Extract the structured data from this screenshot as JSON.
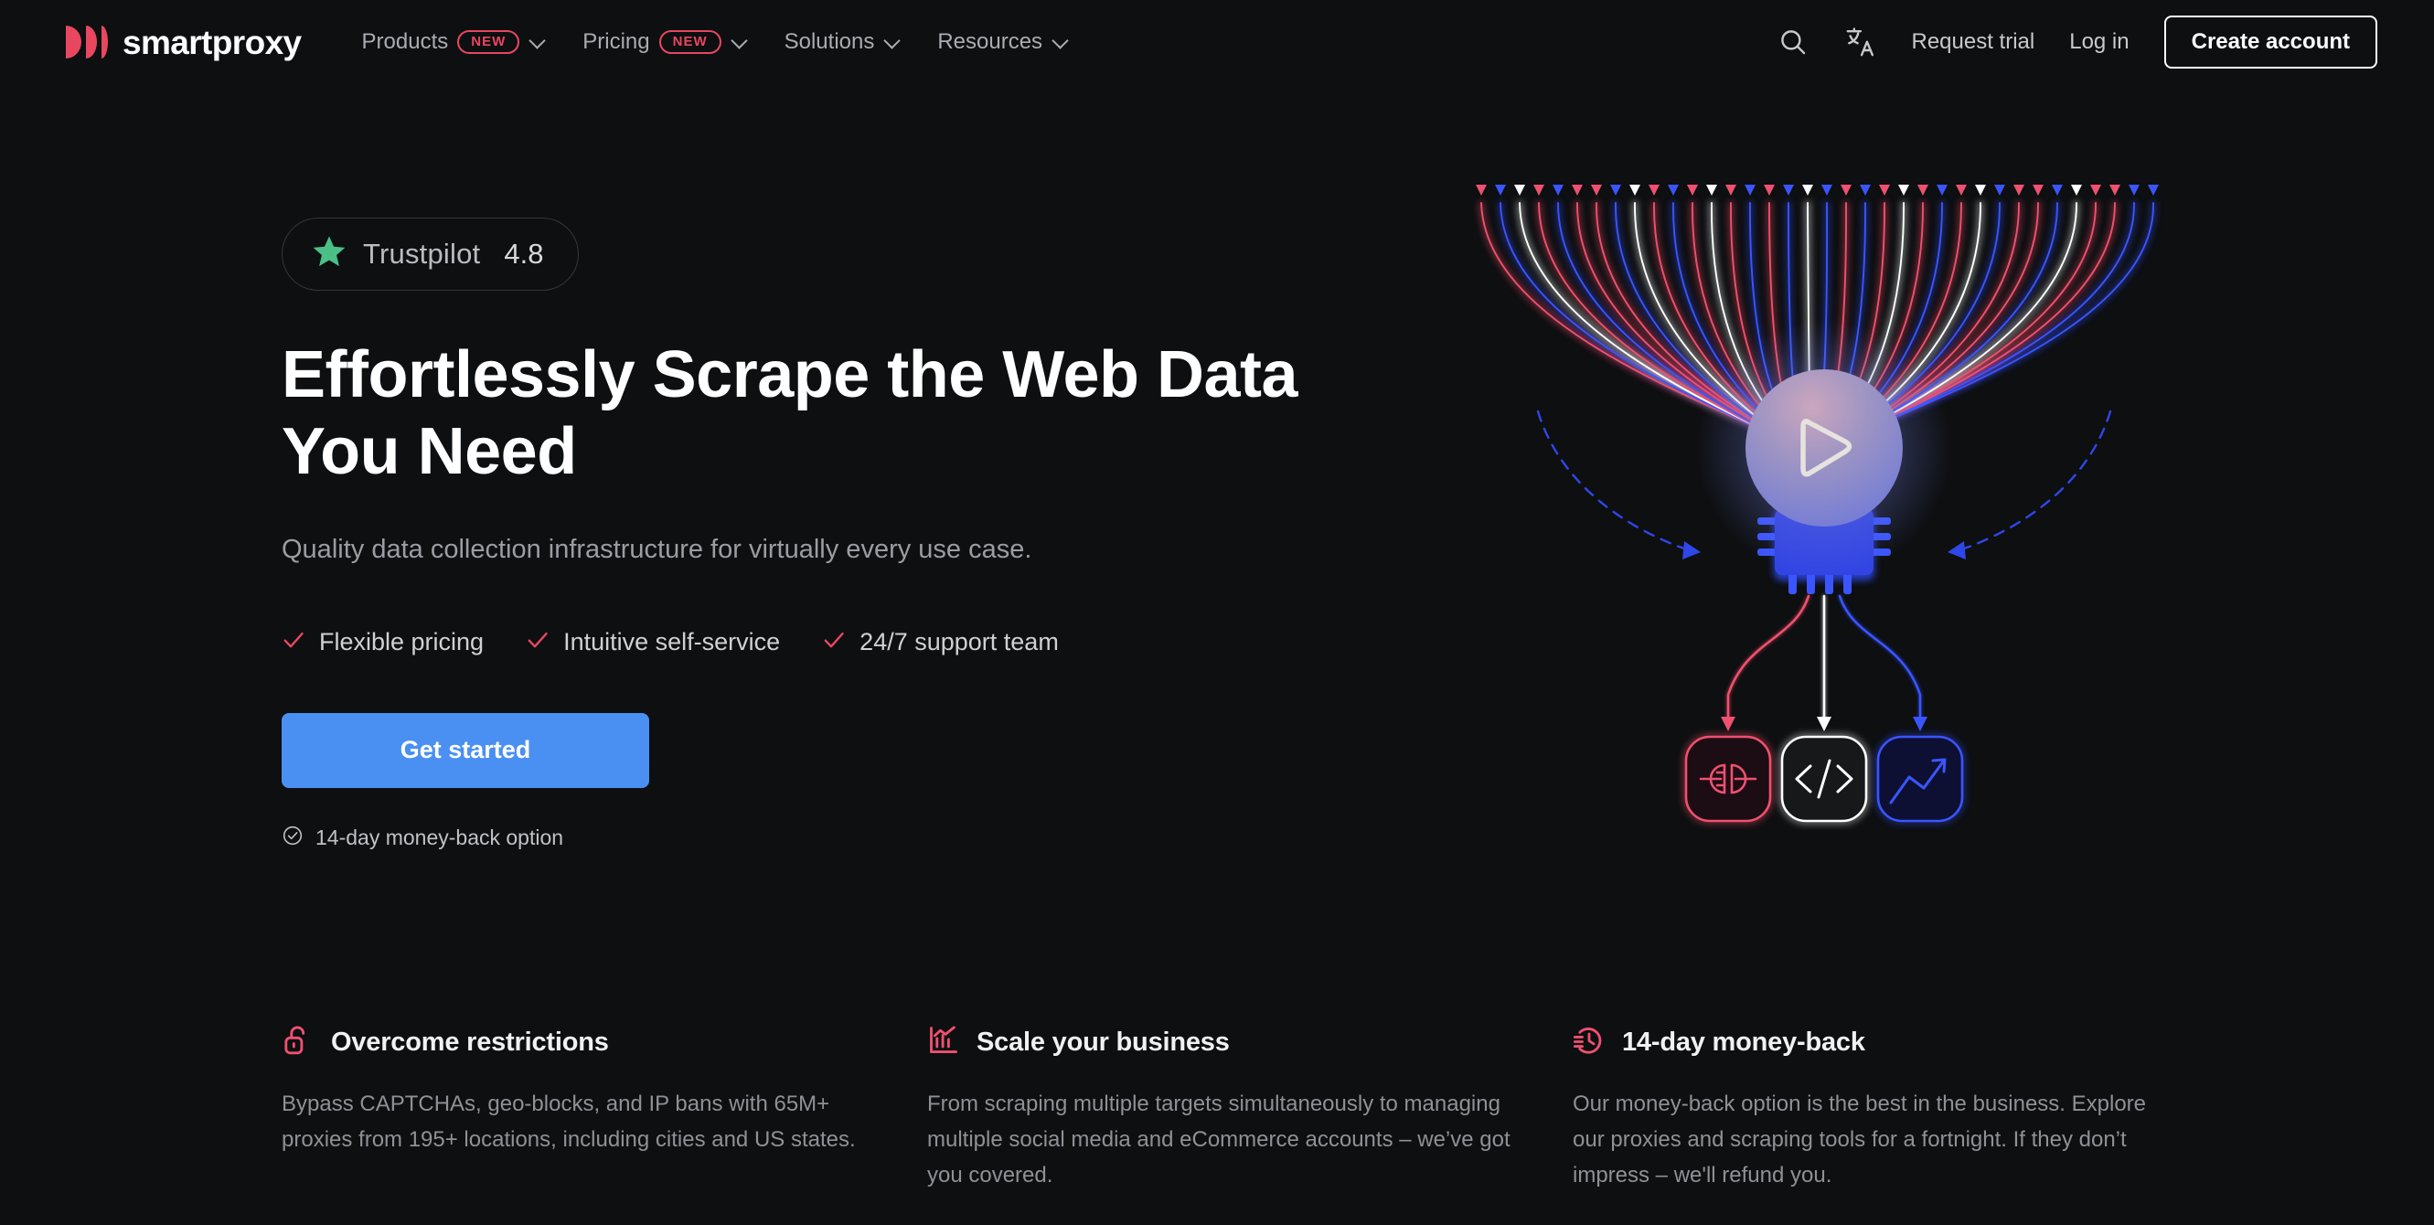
{
  "brand": {
    "name": "smartproxy",
    "logo_icon": "smartproxy-logo-icon",
    "accent_red": "#e8475f",
    "accent_blue": "#4a90f2",
    "background": "#0d0f11"
  },
  "nav": {
    "items": [
      {
        "label": "Products",
        "badge": "NEW",
        "has_dropdown": true,
        "icon": "chevron-down-icon"
      },
      {
        "label": "Pricing",
        "badge": "NEW",
        "has_dropdown": true,
        "icon": "chevron-down-icon"
      },
      {
        "label": "Solutions",
        "badge": "",
        "has_dropdown": true,
        "icon": "chevron-down-icon"
      },
      {
        "label": "Resources",
        "badge": "",
        "has_dropdown": true,
        "icon": "chevron-down-icon"
      }
    ],
    "search_icon": "search-icon",
    "language_icon": "translate-icon",
    "request_trial": "Request trial",
    "log_in": "Log in",
    "create_account": "Create account"
  },
  "hero": {
    "trustpilot": {
      "star_icon": "star-icon",
      "star_color": "#4bbf85",
      "name": "Trustpilot",
      "score": "4.8"
    },
    "title": "Effortlessly Scrape the Web Data You Need",
    "subtitle": "Quality data collection infrastructure for virtually every use case.",
    "checks": [
      {
        "label": "Flexible pricing",
        "icon": "check-icon"
      },
      {
        "label": "Intuitive self-service",
        "icon": "check-icon"
      },
      {
        "label": "24/7 support team",
        "icon": "check-icon"
      }
    ],
    "cta_label": "Get started",
    "moneyback": {
      "icon": "check-circle-icon",
      "label": "14-day money-back option"
    }
  },
  "illustration": {
    "name": "data-funnel-illustration",
    "sphere_icon": "play-sphere-icon",
    "chip_icon": "cpu-chip-icon",
    "outputs": [
      {
        "name": "proxy-plug-card",
        "icon": "plug-connector-icon",
        "color": "#e8475f"
      },
      {
        "name": "code-card",
        "icon": "code-brackets-icon",
        "color": "#ffffff"
      },
      {
        "name": "analytics-card",
        "icon": "trend-up-icon",
        "color": "#3b4fe0"
      }
    ],
    "stream_colors": [
      "#e8475f",
      "#ffffff",
      "#2f47e8"
    ]
  },
  "features": [
    {
      "icon": "unlock-icon",
      "title": "Overcome restrictions",
      "body": "Bypass CAPTCHAs, geo-blocks, and IP bans with 65M+ proxies from 195+ locations, including cities and US states."
    },
    {
      "icon": "bar-chart-icon",
      "title": "Scale your business",
      "body": "From scraping multiple targets simultaneously to managing multiple social media and eCommerce accounts – we’ve got you covered."
    },
    {
      "icon": "money-back-clock-icon",
      "title": "14-day money-back",
      "body": "Our money-back option is the best in the business. Explore our proxies and scraping tools for a fortnight. If they don’t impress – we'll refund you."
    }
  ]
}
